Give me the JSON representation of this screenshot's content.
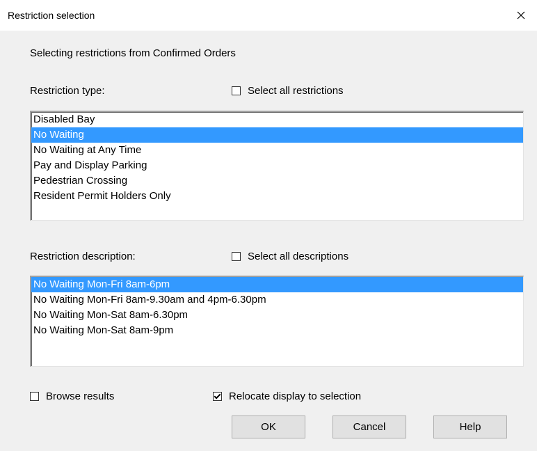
{
  "window": {
    "title": "Restriction selection"
  },
  "intro": "Selecting restrictions from Confirmed Orders",
  "type_section": {
    "label": "Restriction type:",
    "select_all_label": "Select all restrictions",
    "select_all_checked": false,
    "items": [
      {
        "label": "Disabled Bay",
        "selected": false
      },
      {
        "label": "No Waiting",
        "selected": true
      },
      {
        "label": "No Waiting at Any Time",
        "selected": false
      },
      {
        "label": "Pay and Display Parking",
        "selected": false
      },
      {
        "label": "Pedestrian Crossing",
        "selected": false
      },
      {
        "label": "Resident Permit Holders Only",
        "selected": false
      }
    ]
  },
  "description_section": {
    "label": "Restriction description:",
    "select_all_label": "Select all descriptions",
    "select_all_checked": false,
    "items": [
      {
        "label": "No Waiting Mon-Fri 8am-6pm",
        "selected": true
      },
      {
        "label": "No Waiting Mon-Fri 8am-9.30am and 4pm-6.30pm",
        "selected": false
      },
      {
        "label": "No Waiting Mon-Sat 8am-6.30pm",
        "selected": false
      },
      {
        "label": "No Waiting Mon-Sat 8am-9pm",
        "selected": false
      }
    ]
  },
  "options": {
    "browse_label": "Browse results",
    "browse_checked": false,
    "relocate_label": "Relocate display to selection",
    "relocate_checked": true
  },
  "buttons": {
    "ok": "OK",
    "cancel": "Cancel",
    "help": "Help"
  },
  "icons": {
    "close": "close-icon"
  },
  "colors": {
    "selection": "#3399ff",
    "dialog_bg": "#f0f0f0"
  }
}
